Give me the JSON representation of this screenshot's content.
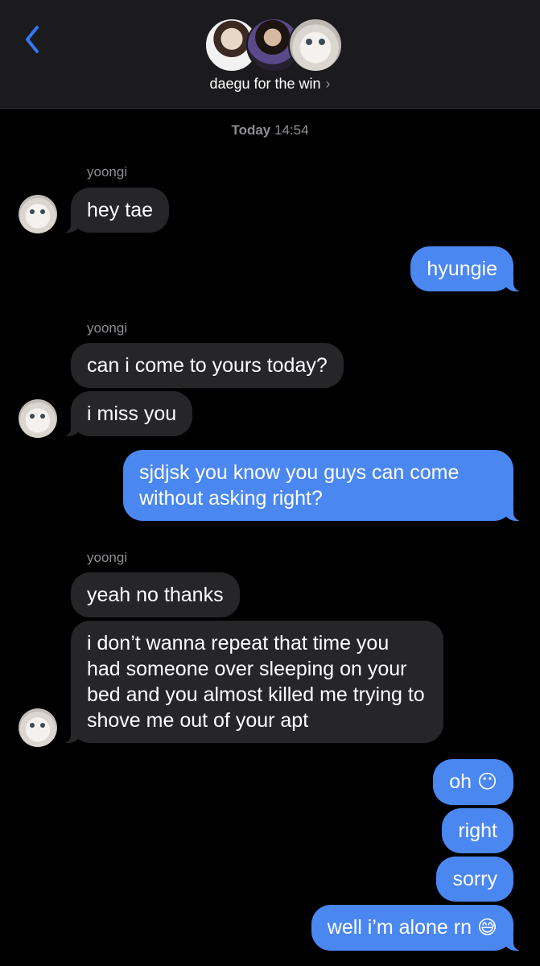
{
  "header": {
    "group_name": "daegu for the win",
    "chevron": "›",
    "back_icon": "chevron-left-icon",
    "accent": "#3478f6"
  },
  "timestamp": {
    "day": "Today",
    "time": "14:54"
  },
  "colors": {
    "incoming_bubble": "#262629",
    "outgoing_bubble": "#4a87f0",
    "background": "#000000"
  },
  "messages": [
    {
      "sender": "yoongi",
      "text": "hey tae"
    },
    {
      "text": "hyungie"
    },
    {
      "sender": "yoongi",
      "text": "can i come to yours today?"
    },
    {
      "text": "i miss you"
    },
    {
      "text": "sjdjsk you know you guys can come without asking right?"
    },
    {
      "sender": "yoongi",
      "text": "yeah no thanks"
    },
    {
      "text": "i don’t wanna repeat that time you had someone over sleeping on your bed and you almost killed me trying to shove me out of your apt"
    },
    {
      "text": "oh",
      "emoji": "😶"
    },
    {
      "text": "right"
    },
    {
      "text": "sorry"
    },
    {
      "text": "well i’m alone rn",
      "emoji": "😅"
    }
  ]
}
